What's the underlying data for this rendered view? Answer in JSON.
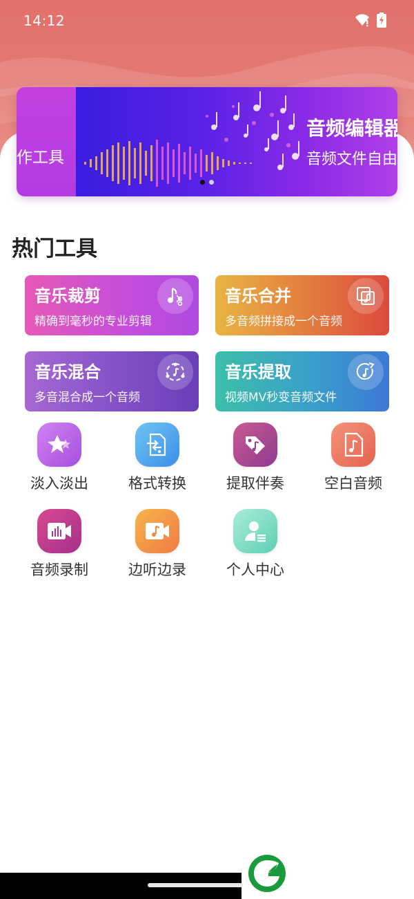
{
  "status_bar": {
    "time": "14:12",
    "icons": [
      "wifi-icon",
      "battery-icon"
    ]
  },
  "banner": {
    "left_text": "作工具",
    "title": "音频编辑器",
    "subtitle": "音频文件自由",
    "dots": 2,
    "active_dot": 1
  },
  "section": {
    "title": "热门工具"
  },
  "tool_cards": [
    {
      "title": "音乐裁剪",
      "desc": "精确到毫秒的专业剪辑",
      "icon": "music-cut-icon"
    },
    {
      "title": "音乐合并",
      "desc": "多音频拼接成一个音频",
      "icon": "music-merge-icon"
    },
    {
      "title": "音乐混合",
      "desc": "多音混合成一个音频",
      "icon": "music-mix-icon"
    },
    {
      "title": "音乐提取",
      "desc": "视频MV秒变音频文件",
      "icon": "music-extract-icon"
    }
  ],
  "grid_tools": [
    {
      "label": "淡入淡出",
      "icon": "star-sparkle-icon"
    },
    {
      "label": "格式转换",
      "icon": "file-convert-icon"
    },
    {
      "label": "提取伴奏",
      "icon": "tag-music-icon"
    },
    {
      "label": "空白音频",
      "icon": "blank-audio-file-icon"
    },
    {
      "label": "音频录制",
      "icon": "audio-record-icon"
    },
    {
      "label": "边听边录",
      "icon": "listen-record-icon"
    },
    {
      "label": "个人中心",
      "icon": "user-profile-icon"
    }
  ],
  "colors": {
    "header": "#e2706a",
    "banner_start": "#3a1ce0",
    "banner_end": "#b03fe8"
  }
}
